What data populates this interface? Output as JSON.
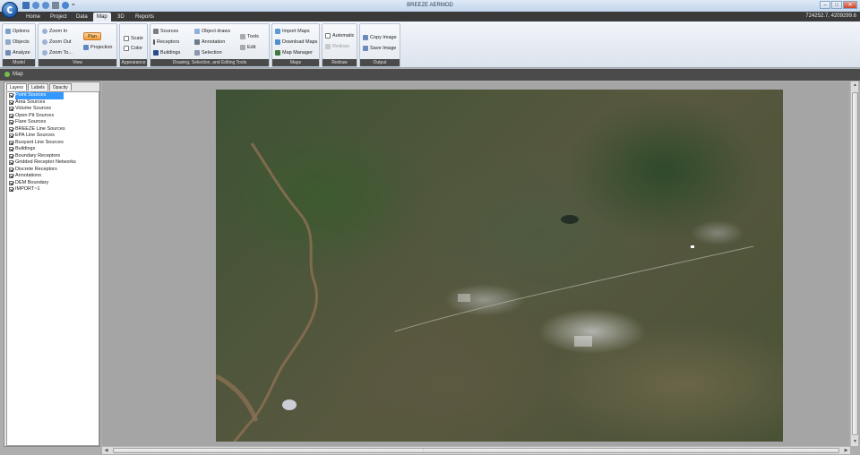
{
  "window": {
    "title": "BREEZE AERMOD",
    "controls": [
      "–",
      "□",
      "✕"
    ]
  },
  "quick_access": {
    "icons": [
      "save-icon",
      "undo-icon",
      "redo-icon",
      "print-icon",
      "help-icon"
    ],
    "customize": "="
  },
  "tabs": [
    {
      "label": "Home"
    },
    {
      "label": "Project"
    },
    {
      "label": "Data"
    },
    {
      "label": "Map"
    },
    {
      "label": "3D"
    },
    {
      "label": "Reports"
    }
  ],
  "active_tab": "Map",
  "coordinates": "724252.7, 4209299.6",
  "ribbon": {
    "groups": [
      {
        "label": "Model",
        "buttons": [
          "Options",
          "Objects",
          "Analyze"
        ]
      },
      {
        "label": "View",
        "buttons": [
          "Zoom In",
          "Zoom Out",
          "Zoom To...",
          "Pan",
          "Projection"
        ]
      },
      {
        "label": "Appearance",
        "buttons": [
          "Scale",
          "Color"
        ]
      },
      {
        "label": "Drawing, Selection, and Editing Tools",
        "buttons": [
          "Sources",
          "Receptors",
          "Buildings",
          "Object draws",
          "Annotation",
          "Selection",
          "Tools",
          "Edit"
        ]
      },
      {
        "label": "Maps",
        "buttons": [
          "Import Maps",
          "Download Maps",
          "Map Manager"
        ]
      },
      {
        "label": "Redraw",
        "buttons": [
          "Automatic",
          "Redraw"
        ]
      },
      {
        "label": "Output",
        "buttons": [
          "Copy Image",
          "Save Image"
        ]
      }
    ]
  },
  "panel": {
    "title": "Map"
  },
  "layers_panel": {
    "tabs": [
      "Layers",
      "Labels",
      "Opacity"
    ],
    "active_tab": "Layers",
    "items": [
      {
        "label": "Point Sources",
        "checked": true,
        "selected": true
      },
      {
        "label": "Area Sources",
        "checked": true
      },
      {
        "label": "Volume Sources",
        "checked": true
      },
      {
        "label": "Open Pit Sources",
        "checked": true
      },
      {
        "label": "Flare Sources",
        "checked": true
      },
      {
        "label": "BREEZE Line Sources",
        "checked": true
      },
      {
        "label": "EPA Line Sources",
        "checked": true
      },
      {
        "label": "Buoyant Line Sources",
        "checked": true
      },
      {
        "label": "Buildings",
        "checked": true
      },
      {
        "label": "Boundary Receptors",
        "checked": true
      },
      {
        "label": "Gridded Receptor Networks",
        "checked": true
      },
      {
        "label": "Discrete Receptors",
        "checked": true
      },
      {
        "label": "Annotations",
        "checked": true
      },
      {
        "label": "DEM Boundary",
        "checked": true
      },
      {
        "label": "IMPORT~1",
        "checked": true
      }
    ]
  },
  "colors": {
    "accent_active_button": "#f49b35",
    "selection": "#3399ff",
    "dark_bar": "#3a3a3a"
  }
}
